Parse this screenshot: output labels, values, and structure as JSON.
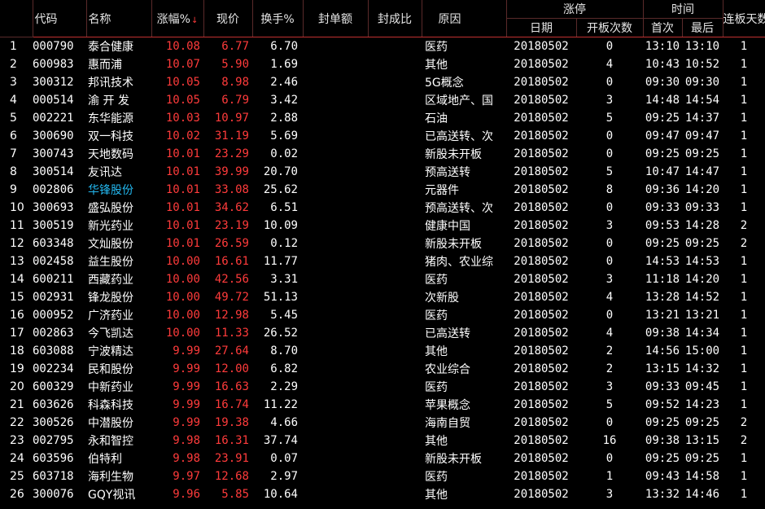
{
  "header": {
    "index": "",
    "code": "代码",
    "name": "名称",
    "change": "涨幅%",
    "change_sort": "↓",
    "price": "现价",
    "turnover": "换手%",
    "seal_amount": "封单额",
    "seal_ratio": "封成比",
    "reason": "原因",
    "limit_up_group": "涨停",
    "date": "日期",
    "open_count": "开板次数",
    "time_group": "时间",
    "first": "首次",
    "last": "最后",
    "streak": "连板天数"
  },
  "rows": [
    {
      "i": "1",
      "code": "000790",
      "name": "泰合健康",
      "chg": "10.08",
      "price": "6.77",
      "turn": "6.70",
      "reason": "医药",
      "date": "20180502",
      "cnt": "0",
      "first": "13:10",
      "last": "13:10",
      "streak": "1"
    },
    {
      "i": "2",
      "code": "600983",
      "name": "惠而浦",
      "chg": "10.07",
      "price": "5.90",
      "turn": "1.69",
      "reason": "其他",
      "date": "20180502",
      "cnt": "4",
      "first": "10:43",
      "last": "10:52",
      "streak": "1"
    },
    {
      "i": "3",
      "code": "300312",
      "name": "邦讯技术",
      "chg": "10.05",
      "price": "8.98",
      "turn": "2.46",
      "reason": "5G概念",
      "date": "20180502",
      "cnt": "0",
      "first": "09:30",
      "last": "09:30",
      "streak": "1"
    },
    {
      "i": "4",
      "code": "000514",
      "name": "渝 开 发",
      "chg": "10.05",
      "price": "6.79",
      "turn": "3.42",
      "reason": "区域地产、国",
      "date": "20180502",
      "cnt": "3",
      "first": "14:48",
      "last": "14:54",
      "streak": "1"
    },
    {
      "i": "5",
      "code": "002221",
      "name": "东华能源",
      "chg": "10.03",
      "price": "10.97",
      "turn": "2.88",
      "reason": "石油",
      "date": "20180502",
      "cnt": "5",
      "first": "09:25",
      "last": "14:37",
      "streak": "1"
    },
    {
      "i": "6",
      "code": "300690",
      "name": "双一科技",
      "chg": "10.02",
      "price": "31.19",
      "turn": "5.69",
      "reason": "已高送转、次",
      "date": "20180502",
      "cnt": "0",
      "first": "09:47",
      "last": "09:47",
      "streak": "1"
    },
    {
      "i": "7",
      "code": "300743",
      "name": "天地数码",
      "chg": "10.01",
      "price": "23.29",
      "turn": "0.02",
      "reason": "新股未开板",
      "date": "20180502",
      "cnt": "0",
      "first": "09:25",
      "last": "09:25",
      "streak": "1"
    },
    {
      "i": "8",
      "code": "300514",
      "name": "友讯达",
      "chg": "10.01",
      "price": "39.99",
      "turn": "20.70",
      "reason": "预高送转",
      "date": "20180502",
      "cnt": "5",
      "first": "10:47",
      "last": "14:47",
      "streak": "1"
    },
    {
      "i": "9",
      "code": "002806",
      "name": "华锋股份",
      "chg": "10.01",
      "price": "33.08",
      "turn": "25.62",
      "reason": "元器件",
      "date": "20180502",
      "cnt": "8",
      "first": "09:36",
      "last": "14:20",
      "streak": "1",
      "hl": true
    },
    {
      "i": "10",
      "code": "300693",
      "name": "盛弘股份",
      "chg": "10.01",
      "price": "34.62",
      "turn": "6.51",
      "reason": "预高送转、次",
      "date": "20180502",
      "cnt": "0",
      "first": "09:33",
      "last": "09:33",
      "streak": "1"
    },
    {
      "i": "11",
      "code": "300519",
      "name": "新光药业",
      "chg": "10.01",
      "price": "23.19",
      "turn": "10.09",
      "reason": "健康中国",
      "date": "20180502",
      "cnt": "3",
      "first": "09:53",
      "last": "14:28",
      "streak": "2"
    },
    {
      "i": "12",
      "code": "603348",
      "name": "文灿股份",
      "chg": "10.01",
      "price": "26.59",
      "turn": "0.12",
      "reason": "新股未开板",
      "date": "20180502",
      "cnt": "0",
      "first": "09:25",
      "last": "09:25",
      "streak": "2"
    },
    {
      "i": "13",
      "code": "002458",
      "name": "益生股份",
      "chg": "10.00",
      "price": "16.61",
      "turn": "11.77",
      "reason": "猪肉、农业综",
      "date": "20180502",
      "cnt": "0",
      "first": "14:53",
      "last": "14:53",
      "streak": "1"
    },
    {
      "i": "14",
      "code": "600211",
      "name": "西藏药业",
      "chg": "10.00",
      "price": "42.56",
      "turn": "3.31",
      "reason": "医药",
      "date": "20180502",
      "cnt": "3",
      "first": "11:18",
      "last": "14:20",
      "streak": "1"
    },
    {
      "i": "15",
      "code": "002931",
      "name": "锋龙股份",
      "chg": "10.00",
      "price": "49.72",
      "turn": "51.13",
      "reason": "次新股",
      "date": "20180502",
      "cnt": "4",
      "first": "13:28",
      "last": "14:52",
      "streak": "1"
    },
    {
      "i": "16",
      "code": "000952",
      "name": "广济药业",
      "chg": "10.00",
      "price": "12.98",
      "turn": "5.45",
      "reason": "医药",
      "date": "20180502",
      "cnt": "0",
      "first": "13:21",
      "last": "13:21",
      "streak": "1"
    },
    {
      "i": "17",
      "code": "002863",
      "name": "今飞凯达",
      "chg": "10.00",
      "price": "11.33",
      "turn": "26.52",
      "reason": "已高送转",
      "date": "20180502",
      "cnt": "4",
      "first": "09:38",
      "last": "14:34",
      "streak": "1"
    },
    {
      "i": "18",
      "code": "603088",
      "name": "宁波精达",
      "chg": "9.99",
      "price": "27.64",
      "turn": "8.70",
      "reason": "其他",
      "date": "20180502",
      "cnt": "2",
      "first": "14:56",
      "last": "15:00",
      "streak": "1"
    },
    {
      "i": "19",
      "code": "002234",
      "name": "民和股份",
      "chg": "9.99",
      "price": "12.00",
      "turn": "6.82",
      "reason": "农业综合",
      "date": "20180502",
      "cnt": "2",
      "first": "13:15",
      "last": "14:32",
      "streak": "1"
    },
    {
      "i": "20",
      "code": "600329",
      "name": "中新药业",
      "chg": "9.99",
      "price": "16.63",
      "turn": "2.29",
      "reason": "医药",
      "date": "20180502",
      "cnt": "3",
      "first": "09:33",
      "last": "09:45",
      "streak": "1"
    },
    {
      "i": "21",
      "code": "603626",
      "name": "科森科技",
      "chg": "9.99",
      "price": "16.74",
      "turn": "11.22",
      "reason": "苹果概念",
      "date": "20180502",
      "cnt": "5",
      "first": "09:52",
      "last": "14:23",
      "streak": "1"
    },
    {
      "i": "22",
      "code": "300526",
      "name": "中潜股份",
      "chg": "9.99",
      "price": "19.38",
      "turn": "4.66",
      "reason": "海南自贸",
      "date": "20180502",
      "cnt": "0",
      "first": "09:25",
      "last": "09:25",
      "streak": "2"
    },
    {
      "i": "23",
      "code": "002795",
      "name": "永和智控",
      "chg": "9.98",
      "price": "16.31",
      "turn": "37.74",
      "reason": "其他",
      "date": "20180502",
      "cnt": "16",
      "first": "09:38",
      "last": "13:15",
      "streak": "2"
    },
    {
      "i": "24",
      "code": "603596",
      "name": "伯特利",
      "chg": "9.98",
      "price": "23.91",
      "turn": "0.07",
      "reason": "新股未开板",
      "date": "20180502",
      "cnt": "0",
      "first": "09:25",
      "last": "09:25",
      "streak": "1"
    },
    {
      "i": "25",
      "code": "603718",
      "name": "海利生物",
      "chg": "9.97",
      "price": "12.68",
      "turn": "2.97",
      "reason": "医药",
      "date": "20180502",
      "cnt": "1",
      "first": "09:43",
      "last": "14:58",
      "streak": "1"
    },
    {
      "i": "26",
      "code": "300076",
      "name": "GQY视讯",
      "chg": "9.96",
      "price": "5.85",
      "turn": "10.64",
      "reason": "其他",
      "date": "20180502",
      "cnt": "3",
      "first": "13:32",
      "last": "14:46",
      "streak": "1"
    }
  ]
}
